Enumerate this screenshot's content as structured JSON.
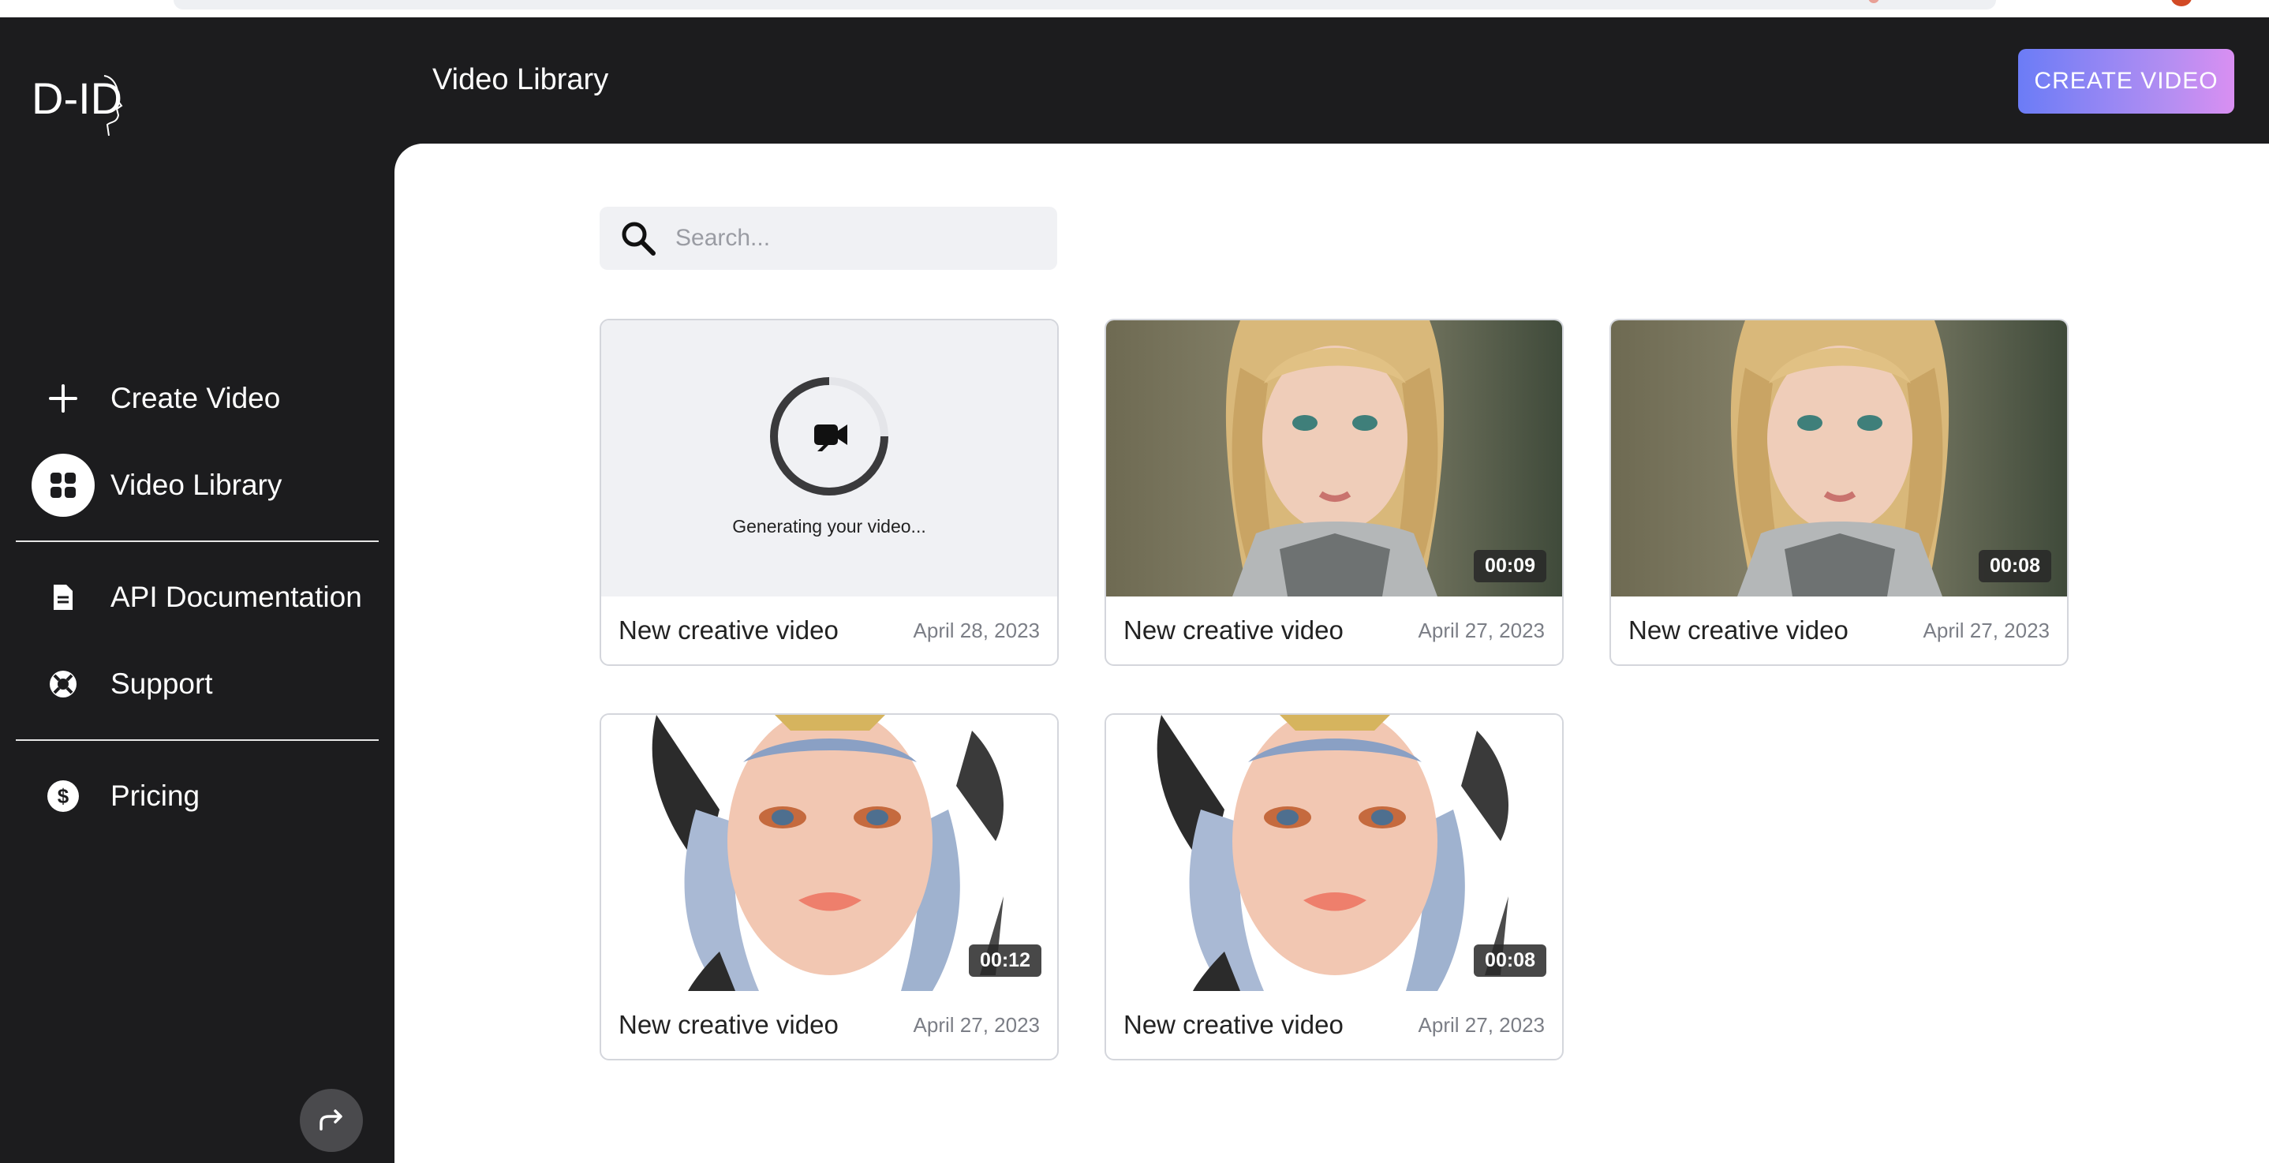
{
  "sidebar": {
    "logo_text": "D-ID",
    "items": [
      {
        "label": "Create Video",
        "icon": "plus-icon"
      },
      {
        "label": "Video Library",
        "icon": "grid-icon",
        "active": true
      },
      {
        "label": "API Documentation",
        "icon": "document-icon"
      },
      {
        "label": "Support",
        "icon": "lifebuoy-icon"
      },
      {
        "label": "Pricing",
        "icon": "dollar-icon"
      }
    ],
    "collapse_icon": "share-arrow-icon"
  },
  "header": {
    "title": "Video Library",
    "create_button": "CREATE VIDEO"
  },
  "search": {
    "placeholder": "Search...",
    "value": ""
  },
  "videos": [
    {
      "title": "New creative video",
      "date": "April 28, 2023",
      "status": "Generating your video...",
      "duration": ""
    },
    {
      "title": "New creative video",
      "date": "April 27, 2023",
      "duration": "00:09",
      "avatar": "blonde-braids"
    },
    {
      "title": "New creative video",
      "date": "April 27, 2023",
      "duration": "00:08",
      "avatar": "blonde-braids"
    },
    {
      "title": "New creative video",
      "date": "April 27, 2023",
      "duration": "00:12",
      "avatar": "feather-girl"
    },
    {
      "title": "New creative video",
      "date": "April 27, 2023",
      "duration": "00:08",
      "avatar": "feather-girl"
    }
  ],
  "colors": {
    "sidebar_bg": "#1c1c1e",
    "accent_gradient_start": "#6b7cf6",
    "accent_gradient_end": "#d98ff2"
  }
}
